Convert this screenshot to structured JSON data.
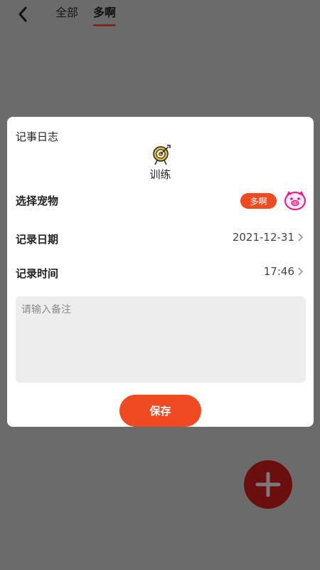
{
  "header": {
    "tabs": [
      {
        "label": "全部"
      },
      {
        "label": "多啊"
      }
    ]
  },
  "dialog": {
    "title": "记事日志",
    "category": {
      "label": "训练",
      "icon": "target-icon"
    },
    "pet": {
      "label": "选择宠物",
      "badge": "多啊",
      "avatar": "pig-avatar-icon"
    },
    "date": {
      "label": "记录日期",
      "value": "2021-12-31"
    },
    "time": {
      "label": "记录时间",
      "value": "17:46"
    },
    "note": {
      "placeholder": "请输入备注",
      "value": ""
    },
    "save_label": "保存"
  },
  "colors": {
    "accent": "#f04a22",
    "overlay": "#6b6b6b",
    "fab": "#6a0e0e"
  }
}
